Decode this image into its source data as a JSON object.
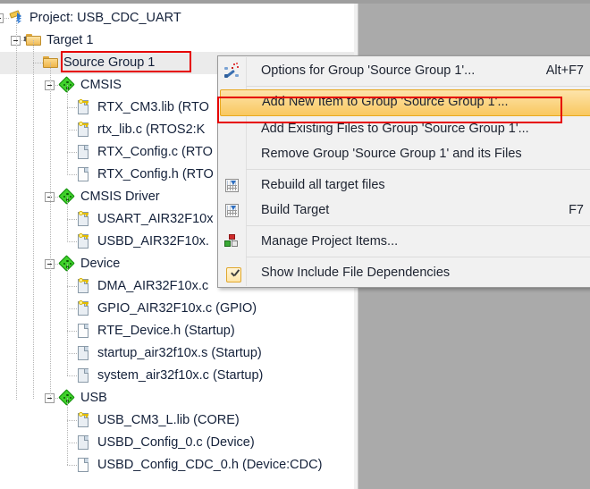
{
  "window": {
    "panel_name": "Project",
    "background_color": "#aaaaaa",
    "panel_background": "#ffffff"
  },
  "tree": {
    "selected_item": "Source Group 1",
    "items": [
      {
        "label": "Project: USB_CDC_UART",
        "depth": 0,
        "icon": "project-icon",
        "expander": "minus"
      },
      {
        "label": "Target 1",
        "depth": 1,
        "icon": "target-folder-icon",
        "expander": "minus"
      },
      {
        "label": "Source Group 1",
        "depth": 2,
        "icon": "folder-icon",
        "expander": "none",
        "selected": true,
        "annotated": true
      },
      {
        "label": "CMSIS",
        "depth": 3,
        "icon": "component-icon",
        "expander": "minus"
      },
      {
        "label": "RTX_CM3.lib (RTO",
        "depth": 4,
        "icon": "lib-key-file-icon",
        "expander": "none"
      },
      {
        "label": "rtx_lib.c (RTOS2:K",
        "depth": 4,
        "icon": "lib-key-file-icon",
        "expander": "none"
      },
      {
        "label": "RTX_Config.c (RTO",
        "depth": 4,
        "icon": "source-file-icon",
        "expander": "none"
      },
      {
        "label": "RTX_Config.h (RTO",
        "depth": 4,
        "icon": "header-file-icon",
        "expander": "none"
      },
      {
        "label": "CMSIS Driver",
        "depth": 3,
        "icon": "component-icon",
        "expander": "minus"
      },
      {
        "label": "USART_AIR32F10x",
        "depth": 4,
        "icon": "lib-key-file-icon",
        "expander": "none"
      },
      {
        "label": "USBD_AIR32F10x.",
        "depth": 4,
        "icon": "lib-key-file-icon",
        "expander": "none"
      },
      {
        "label": "Device",
        "depth": 3,
        "icon": "component-icon",
        "expander": "minus"
      },
      {
        "label": "DMA_AIR32F10x.c",
        "depth": 4,
        "icon": "lib-key-file-icon",
        "expander": "none"
      },
      {
        "label": "GPIO_AIR32F10x.c (GPIO)",
        "depth": 4,
        "icon": "lib-key-file-icon",
        "expander": "none"
      },
      {
        "label": "RTE_Device.h (Startup)",
        "depth": 4,
        "icon": "header-file-icon",
        "expander": "none"
      },
      {
        "label": "startup_air32f10x.s (Startup)",
        "depth": 4,
        "icon": "source-file-icon",
        "expander": "none"
      },
      {
        "label": "system_air32f10x.c (Startup)",
        "depth": 4,
        "icon": "source-file-icon",
        "expander": "none"
      },
      {
        "label": "USB",
        "depth": 3,
        "icon": "component-icon",
        "expander": "minus"
      },
      {
        "label": "USB_CM3_L.lib (CORE)",
        "depth": 4,
        "icon": "lib-key-file-icon",
        "expander": "none"
      },
      {
        "label": "USBD_Config_0.c (Device)",
        "depth": 4,
        "icon": "source-file-icon",
        "expander": "none"
      },
      {
        "label": "USBD_Config_CDC_0.h (Device:CDC)",
        "depth": 4,
        "icon": "header-file-icon",
        "expander": "none"
      }
    ]
  },
  "context_menu": {
    "highlighted_item": "Add New  Item to Group 'Source Group 1'...",
    "items": [
      {
        "type": "item",
        "label": "Options for Group 'Source Group 1'...",
        "shortcut": "Alt+F7",
        "icon": "wand-icon"
      },
      {
        "type": "separator"
      },
      {
        "type": "item",
        "label": "Add New  Item to Group 'Source Group 1'...",
        "shortcut": "",
        "icon": "none",
        "highlighted": true,
        "annotated": true
      },
      {
        "type": "item",
        "label": "Add Existing Files to Group 'Source Group 1'...",
        "shortcut": "",
        "icon": "none"
      },
      {
        "type": "item",
        "label": "Remove Group 'Source Group 1' and its Files",
        "shortcut": "",
        "icon": "none"
      },
      {
        "type": "separator"
      },
      {
        "type": "item",
        "label": "Rebuild all target files",
        "shortcut": "",
        "icon": "rebuild-icon"
      },
      {
        "type": "item",
        "label": "Build Target",
        "shortcut": "F7",
        "icon": "build-icon"
      },
      {
        "type": "separator"
      },
      {
        "type": "item",
        "label": "Manage Project Items...",
        "shortcut": "",
        "icon": "manage-items-icon"
      },
      {
        "type": "separator"
      },
      {
        "type": "item",
        "label": "Show Include File Dependencies",
        "shortcut": "",
        "icon": "checkbox-checked-icon",
        "checked": true
      }
    ]
  },
  "annotations": {
    "highlight_color": "#e60000",
    "boxes": [
      "source-group-1-tree-item",
      "add-new-item-menu-entry"
    ]
  }
}
